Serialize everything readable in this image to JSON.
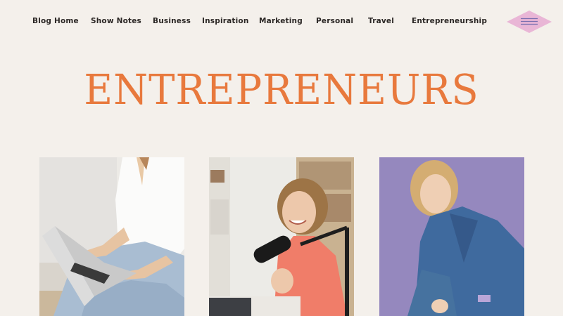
{
  "nav": {
    "items": [
      {
        "label": "Blog Home"
      },
      {
        "label": "Show Notes"
      },
      {
        "label": "Business"
      },
      {
        "label": "Inspiration"
      },
      {
        "label": "Marketing"
      },
      {
        "label": "Personal"
      },
      {
        "label": "Travel"
      },
      {
        "label": "Entrepreneurship"
      }
    ],
    "menu_icon": "hamburger-menu-icon"
  },
  "page": {
    "title": "ENTREPRENEURS"
  },
  "cards": [
    {
      "image": "woman-typing-on-laptop-photo"
    },
    {
      "image": "woman-laughing-at-podcast-microphone-photo"
    },
    {
      "image": "woman-in-blue-suit-portrait-photo"
    }
  ],
  "colors": {
    "background": "#f4f0eb",
    "accent": "#e8793d",
    "nav_text": "#2a2624",
    "menu_button": "#e9b6d6",
    "menu_lines": "#7a6fb0"
  }
}
